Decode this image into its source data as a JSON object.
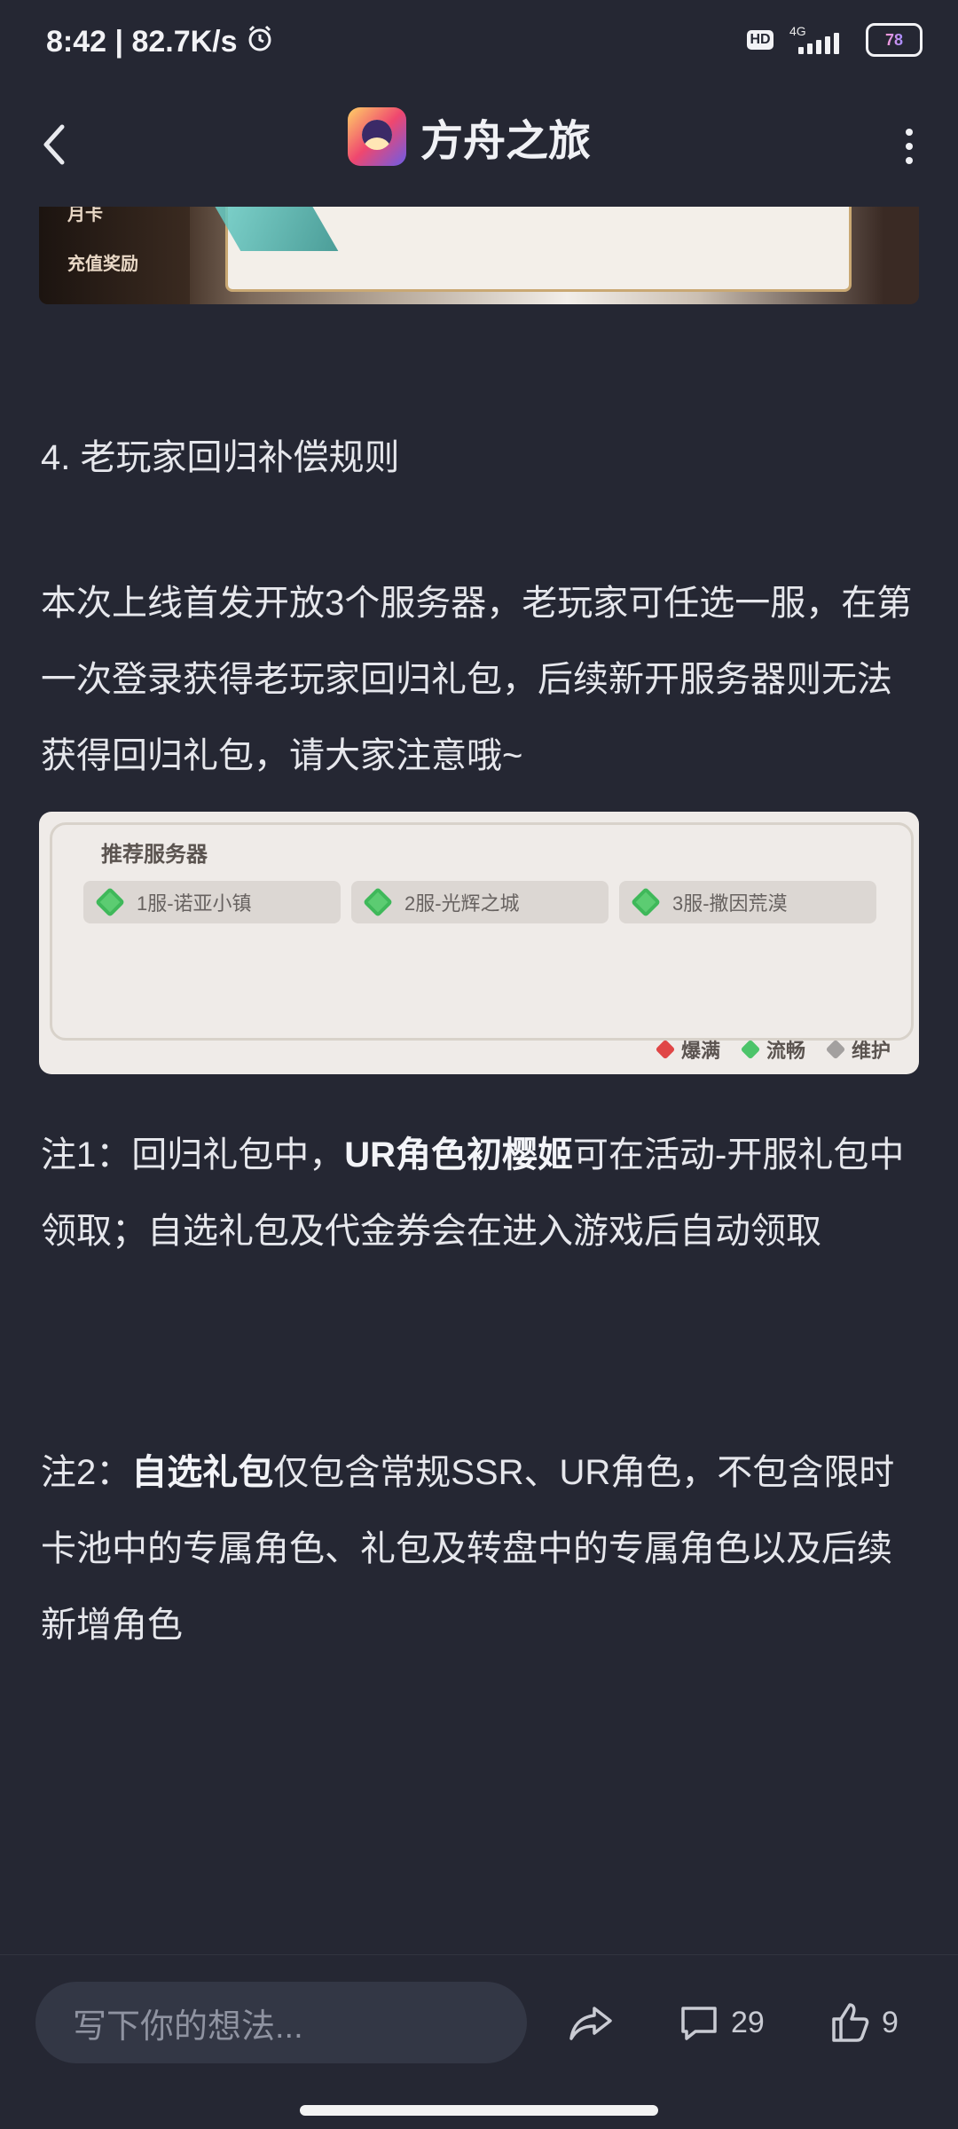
{
  "status_bar": {
    "time_speed": "8:42 | 82.7K/s",
    "hd_label": "HD",
    "network_label": "4G",
    "battery_level": "78"
  },
  "header": {
    "title": "方舟之旅"
  },
  "banner": {
    "label_top": "月卡",
    "label_bottom": "充值奖励"
  },
  "content": {
    "heading": "4. 老玩家回归补偿规则",
    "paragraph": "本次上线首发开放3个服务器，老玩家可任选一服，在第一次登录获得老玩家回归礼包，后续新开服务器则无法获得回归礼包，请大家注意哦~",
    "note1": {
      "prefix": "注1：回归礼包中，",
      "bold": "UR角色初樱姬",
      "suffix": "可在活动-开服礼包中领取；自选礼包及代金券会在进入游戏后自动领取"
    },
    "note2": {
      "prefix": "注2：",
      "bold": "自选礼包",
      "suffix": "仅包含常规SSR、UR角色，不包含限时卡池中的专属角色、礼包及转盘中的专属角色以及后续新增角色"
    }
  },
  "server_image": {
    "heading": "推荐服务器",
    "servers": [
      "1服-诺亚小镇",
      "2服-光辉之城",
      "3服-撒因荒漠"
    ],
    "legend": [
      "爆满",
      "流畅",
      "维护"
    ]
  },
  "bottom_bar": {
    "input_placeholder": "写下你的想法...",
    "comment_count": "29",
    "like_count": "9"
  }
}
